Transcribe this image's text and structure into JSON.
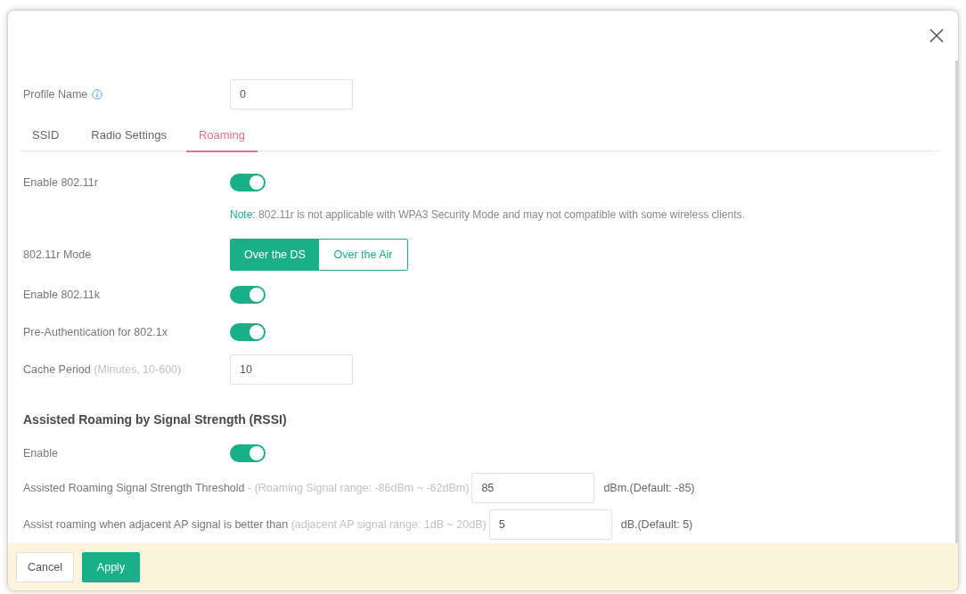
{
  "profile_name": {
    "label": "Profile Name",
    "value": "0"
  },
  "tabs": [
    {
      "label": "SSID",
      "selected": false
    },
    {
      "label": "Radio Settings",
      "selected": false
    },
    {
      "label": "Roaming",
      "selected": true
    }
  ],
  "settings": [
    {
      "kind": "toggle",
      "label": "Enable 802.11r",
      "on": true
    },
    {
      "kind": "note",
      "prefix": "Note:",
      "text": "802.11r is not applicable with WPA3 Security Mode and may not compatible with some wireless clients."
    },
    {
      "kind": "segmented",
      "label": "802.11r Mode",
      "options": [
        {
          "label": "Over the DS",
          "selected": true
        },
        {
          "label": "Over the Air",
          "selected": false
        }
      ]
    },
    {
      "kind": "toggle",
      "label": "Enable 802.11k",
      "on": true
    },
    {
      "kind": "toggle",
      "label": "Pre-Authentication for 802.1x",
      "on": true
    },
    {
      "kind": "input",
      "label": "Cache Period",
      "hint": "(Minutes, 10-600)",
      "value": "10"
    }
  ],
  "rssi_section": {
    "title": "Assisted Roaming by Signal Strength (RSSI)",
    "rows": [
      {
        "kind": "toggle",
        "label": "Enable",
        "on": true
      },
      {
        "kind": "threshold",
        "label": "Assisted Roaming Signal Strength Threshold",
        "hint": "- (Roaming Signal range: -86dBm ~ -62dBm)",
        "value": "85",
        "suffix": "dBm.(Default: -85)"
      },
      {
        "kind": "threshold",
        "label": "Assist roaming when adjacent AP signal is better than",
        "hint": "(adjacent AP signal range: 1dB ~ 20dB)",
        "value": "5",
        "suffix": "dB.(Default: 5)"
      }
    ]
  },
  "footer": {
    "buttons": [
      {
        "kind": "outline",
        "label": "Cancel"
      },
      {
        "kind": "filled",
        "label": "Apply"
      }
    ]
  }
}
